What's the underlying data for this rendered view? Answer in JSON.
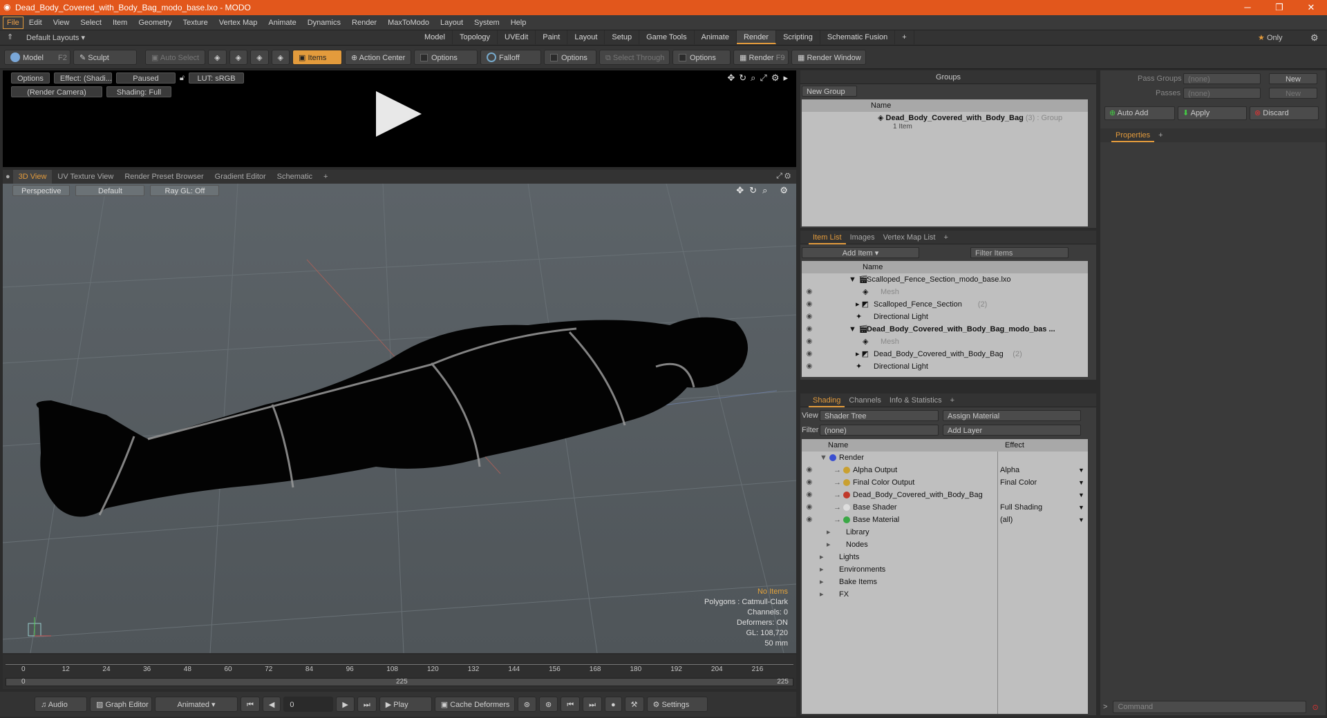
{
  "app": {
    "title": "Dead_Body_Covered_with_Body_Bag_modo_base.lxo - MODO"
  },
  "window": {
    "min": "─",
    "max": "❐",
    "close": "✕"
  },
  "menu": [
    "File",
    "Edit",
    "View",
    "Select",
    "Item",
    "Geometry",
    "Texture",
    "Vertex Map",
    "Animate",
    "Dynamics",
    "Render",
    "MaxToModo",
    "Layout",
    "System",
    "Help"
  ],
  "layout": {
    "preset": "Default Layouts",
    "tabs": [
      "Model",
      "Topology",
      "UVEdit",
      "Paint",
      "Layout",
      "Setup",
      "Game Tools",
      "Animate",
      "Render",
      "Scripting",
      "Schematic Fusion"
    ],
    "active": "Render",
    "only": "Only"
  },
  "toolbar": {
    "model": "Model",
    "model_key": "F2",
    "sculpt": "Sculpt",
    "auto_select": "Auto Select",
    "items": "Items",
    "action_center": "Action Center",
    "options1": "Options",
    "falloff": "Falloff",
    "options2": "Options",
    "select_through": "Select Through",
    "options3": "Options",
    "render": "Render",
    "render_key": "F9",
    "render_window": "Render Window"
  },
  "preview": {
    "options": "Options",
    "effect": "Effect: (Shadi...",
    "paused": "Paused",
    "lut": "LUT: sRGB",
    "camera": "(Render Camera)",
    "shading": "Shading: Full"
  },
  "viewtabs": [
    "3D View",
    "UV Texture View",
    "Render Preset Browser",
    "Gradient Editor",
    "Schematic"
  ],
  "viewport": {
    "perspective": "Perspective",
    "default": "Default",
    "raygl": "Ray GL: Off"
  },
  "stats": {
    "no_items": "No Items",
    "polygons": "Polygons : Catmull-Clark",
    "channels": "Channels: 0",
    "deformers": "Deformers: ON",
    "gl": "GL: 108,720",
    "mm": "50 mm"
  },
  "timeline": {
    "ticks": [
      "0",
      "12",
      "24",
      "36",
      "48",
      "60",
      "72",
      "84",
      "96",
      "108",
      "120",
      "132",
      "144",
      "156",
      "168",
      "180",
      "192",
      "204",
      "216"
    ],
    "start": "0",
    "mid": "225",
    "end": "225"
  },
  "bottom": {
    "audio": "Audio",
    "graph_editor": "Graph Editor",
    "animated": "Animated",
    "frame": "0",
    "play": "Play",
    "cache": "Cache Deformers",
    "settings": "Settings"
  },
  "groups": {
    "title": "Groups",
    "new_group": "New Group",
    "col_name": "Name",
    "item_name": "Dead_Body_Covered_with_Body_Bag",
    "item_count": "(3)",
    "item_type": ": Group",
    "item_sub": "1 Item"
  },
  "passes": {
    "pass_groups": "Pass Groups",
    "passes": "Passes",
    "none": "(none)",
    "new": "New",
    "auto_add": "Auto Add",
    "apply": "Apply",
    "discard": "Discard",
    "properties": "Properties"
  },
  "itemlist": {
    "tabs": [
      "Item List",
      "Images",
      "Vertex Map List"
    ],
    "add_item": "Add Item",
    "filter": "Filter Items",
    "col_name": "Name",
    "rows": [
      {
        "name": "Scalloped_Fence_Section_modo_base.lxo",
        "indent": 0,
        "kind": "scene",
        "eye": false
      },
      {
        "name": "Mesh",
        "indent": 2,
        "kind": "mesh",
        "eye": true,
        "gray": true
      },
      {
        "name": "Scalloped_Fence_Section",
        "count": "(2)",
        "indent": 1,
        "kind": "group",
        "eye": true
      },
      {
        "name": "Directional Light",
        "indent": 1,
        "kind": "light",
        "eye": true
      },
      {
        "name": "Dead_Body_Covered_with_Body_Bag_modo_bas ...",
        "indent": 0,
        "kind": "scene",
        "eye": true,
        "bold": true
      },
      {
        "name": "Mesh",
        "indent": 2,
        "kind": "mesh",
        "eye": true,
        "gray": true
      },
      {
        "name": "Dead_Body_Covered_with_Body_Bag",
        "count": "(2)",
        "indent": 1,
        "kind": "group",
        "eye": true
      },
      {
        "name": "Directional Light",
        "indent": 1,
        "kind": "light",
        "eye": true
      }
    ]
  },
  "shading": {
    "tabs": [
      "Shading",
      "Channels",
      "Info & Statistics"
    ],
    "view_label": "View",
    "view_value": "Shader Tree",
    "assign": "Assign Material",
    "filter_label": "Filter",
    "filter_value": "(none)",
    "add_layer": "Add Layer",
    "col_name": "Name",
    "col_effect": "Effect",
    "rows": [
      {
        "name": "Render",
        "effect": "",
        "indent": 0,
        "eye": false,
        "color": "#3a4fd0"
      },
      {
        "name": "Alpha Output",
        "effect": "Alpha",
        "indent": 2,
        "eye": true,
        "color": "#c9a030"
      },
      {
        "name": "Final Color Output",
        "effect": "Final Color",
        "indent": 2,
        "eye": true,
        "color": "#c9a030"
      },
      {
        "name": "Dead_Body_Covered_with_Body_Bag",
        "effect": "",
        "indent": 2,
        "eye": true,
        "color": "#c0392b"
      },
      {
        "name": "Base Shader",
        "effect": "Full Shading",
        "indent": 2,
        "eye": true,
        "color": "#dddddd"
      },
      {
        "name": "Base Material",
        "effect": "(all)",
        "indent": 2,
        "eye": true,
        "color": "#3aa845"
      },
      {
        "name": "Library",
        "effect": "",
        "indent": 1,
        "eye": false,
        "color": ""
      },
      {
        "name": "Nodes",
        "effect": "",
        "indent": 1,
        "eye": false,
        "color": ""
      },
      {
        "name": "Lights",
        "effect": "",
        "indent": 0,
        "eye": false,
        "color": ""
      },
      {
        "name": "Environments",
        "effect": "",
        "indent": 0,
        "eye": false,
        "color": ""
      },
      {
        "name": "Bake Items",
        "effect": "",
        "indent": 0,
        "eye": false,
        "color": ""
      },
      {
        "name": "FX",
        "effect": "",
        "indent": 0,
        "eye": false,
        "color": ""
      }
    ]
  },
  "command": {
    "placeholder": "Command"
  }
}
